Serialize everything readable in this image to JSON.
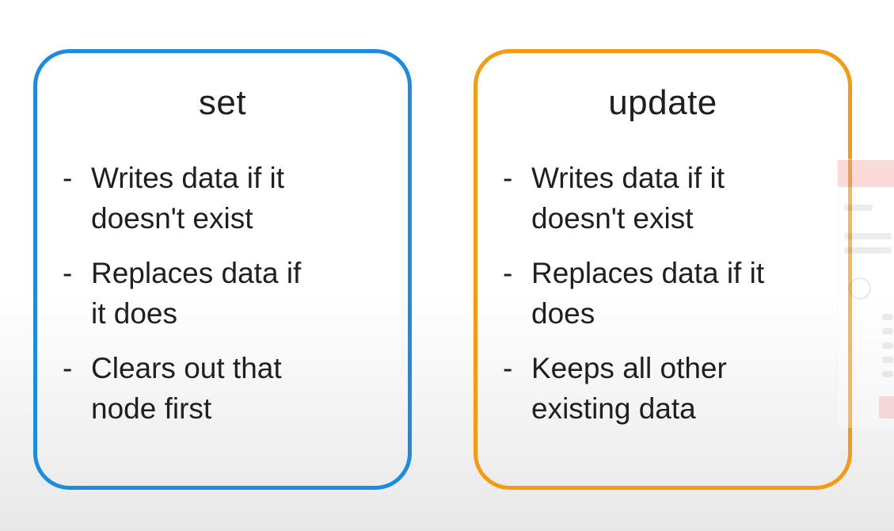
{
  "cards": [
    {
      "title": "set",
      "border_color": "#1a8de0",
      "items": [
        {
          "dash": "-",
          "lines": [
            "Writes data if it",
            "doesn't exist"
          ]
        },
        {
          "dash": "-",
          "lines": [
            "Replaces data if",
            "it does"
          ]
        },
        {
          "dash": "-",
          "lines": [
            "Clears out that",
            "node first"
          ]
        }
      ]
    },
    {
      "title": "update",
      "border_color": "#f59a12",
      "items": [
        {
          "dash": "-",
          "lines": [
            "Writes data if it",
            "doesn't exist"
          ]
        },
        {
          "dash": "-",
          "lines": [
            "Replaces data if it",
            "does"
          ]
        },
        {
          "dash": "-",
          "lines": [
            "Keeps all other",
            "existing data"
          ]
        }
      ]
    }
  ]
}
